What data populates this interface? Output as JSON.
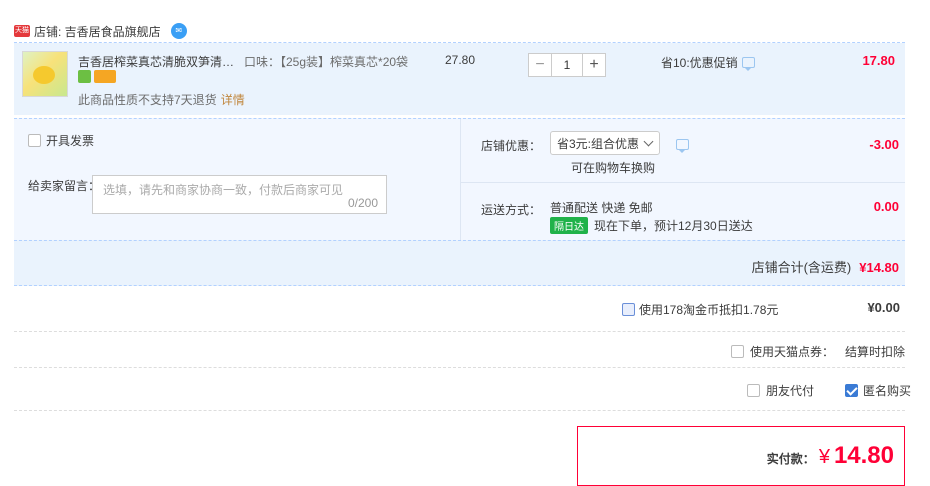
{
  "shop": {
    "badge": "天猫",
    "name": "店铺: 吉香居食品旗舰店"
  },
  "item": {
    "title": "吉香居榨菜真芯清脆双笋清淡榨...",
    "sku": "口味：【25g装】榨菜真芯*20袋",
    "no_return": "此商品性质不支持7天退货",
    "detail_link": "详情",
    "unit_price": "27.80",
    "qty": "1",
    "minus": "−",
    "plus": "+",
    "promo": "省10:优惠促销",
    "total": "17.80"
  },
  "options": {
    "invoice_label": "开具发票",
    "msg_label": "给卖家留言：",
    "msg_placeholder": "选填，请先和商家协商一致，付款后商家可见",
    "msg_count": "0/200",
    "discount_label": "店铺优惠：",
    "discount_selected": "省3元:组合优惠",
    "discount_note": "可在购物车换购",
    "discount_value": "-3.00",
    "ship_label": "运送方式：",
    "ship_method": "普通配送 快递 免邮",
    "ship_tag": "隔日达",
    "ship_eta": "现在下单，预计12月30日送达",
    "ship_value": "0.00"
  },
  "shop_total": {
    "label": "店铺合计(含运费)",
    "value": "¥14.80"
  },
  "extras": {
    "coin_label": "使用178淘金币抵扣1.78元",
    "coin_value": "¥0.00",
    "point_label": "使用天猫点券：",
    "settle_label": "结算时扣除",
    "friend_label": "朋友代付",
    "anon_label": "匿名购买"
  },
  "pay": {
    "label": "实付款：",
    "currency": "¥",
    "amount": "14.80"
  },
  "colors": {
    "accent": "#ff0036",
    "row_bg": "#eaf3fd",
    "block_bg": "#f2f7ff"
  }
}
